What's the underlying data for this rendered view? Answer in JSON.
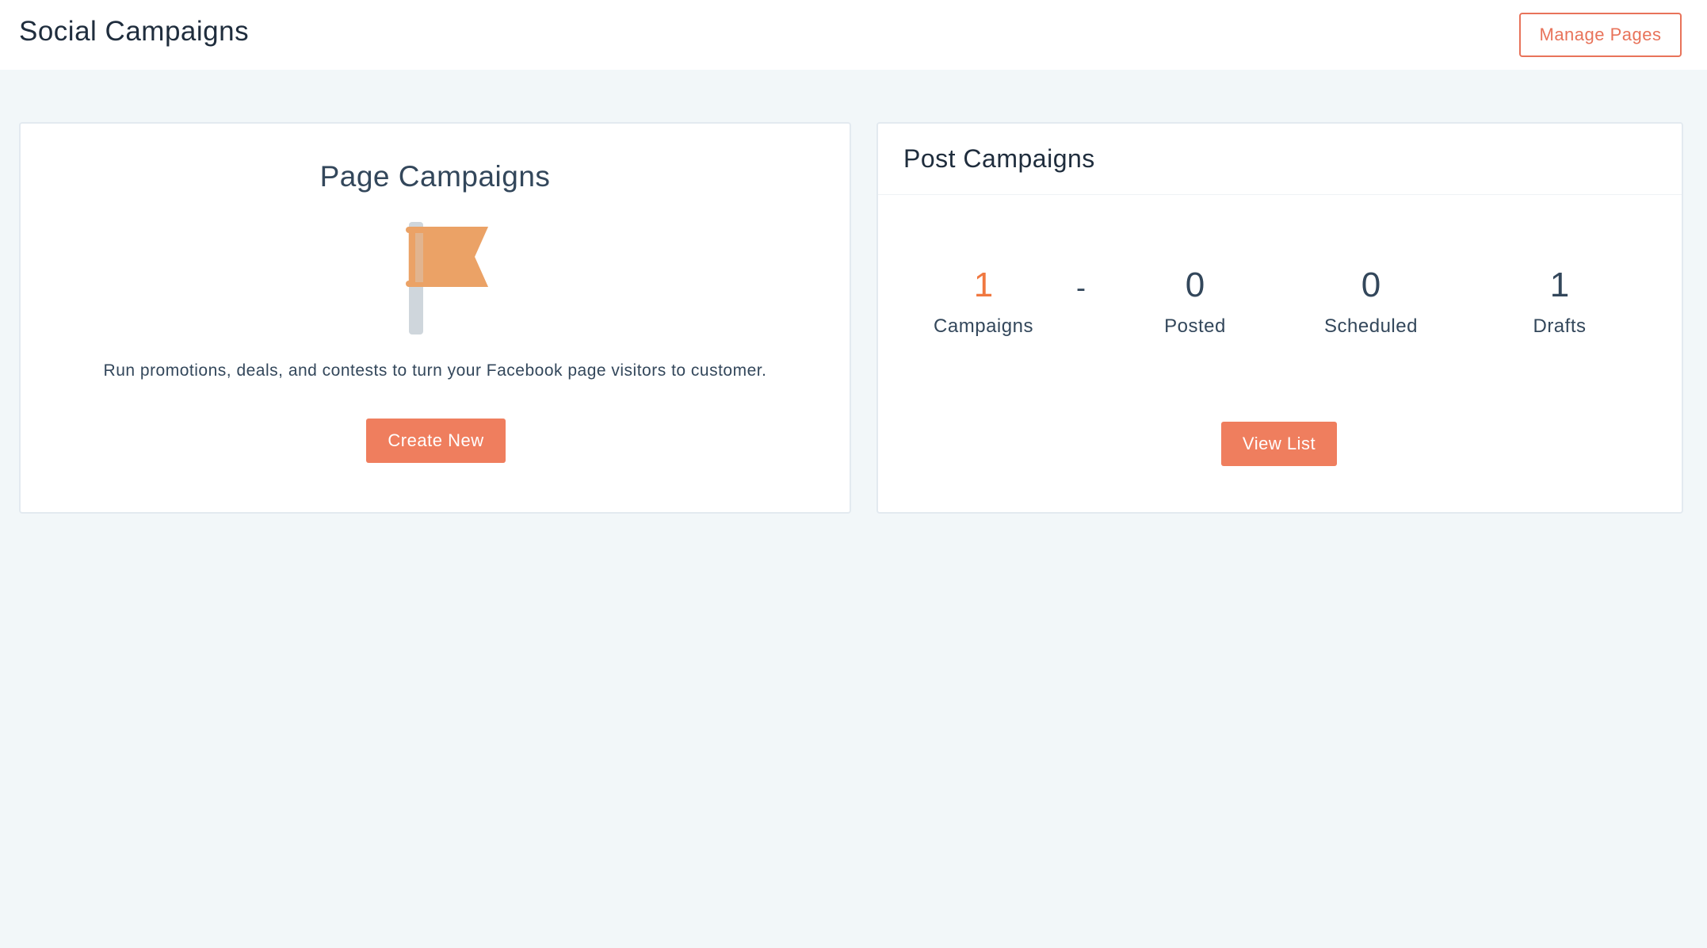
{
  "header": {
    "title": "Social Campaigns",
    "manage_pages_label": "Manage Pages"
  },
  "page_campaigns": {
    "title": "Page Campaigns",
    "icon": "flag-icon",
    "description": "Run promotions, deals, and contests to turn your Facebook page visitors to customer.",
    "create_label": "Create New"
  },
  "post_campaigns": {
    "title": "Post Campaigns",
    "separator": "-",
    "stats": [
      {
        "value": "1",
        "label": "Campaigns"
      },
      {
        "value": "0",
        "label": "Posted"
      },
      {
        "value": "0",
        "label": "Scheduled"
      },
      {
        "value": "1",
        "label": "Drafts"
      }
    ],
    "view_list_label": "View List"
  },
  "colors": {
    "accent": "#ef7e5e",
    "accent_text": "#f07840",
    "flag": "#eba266",
    "pole": "#cfd6dc",
    "background": "#f2f7f9"
  }
}
